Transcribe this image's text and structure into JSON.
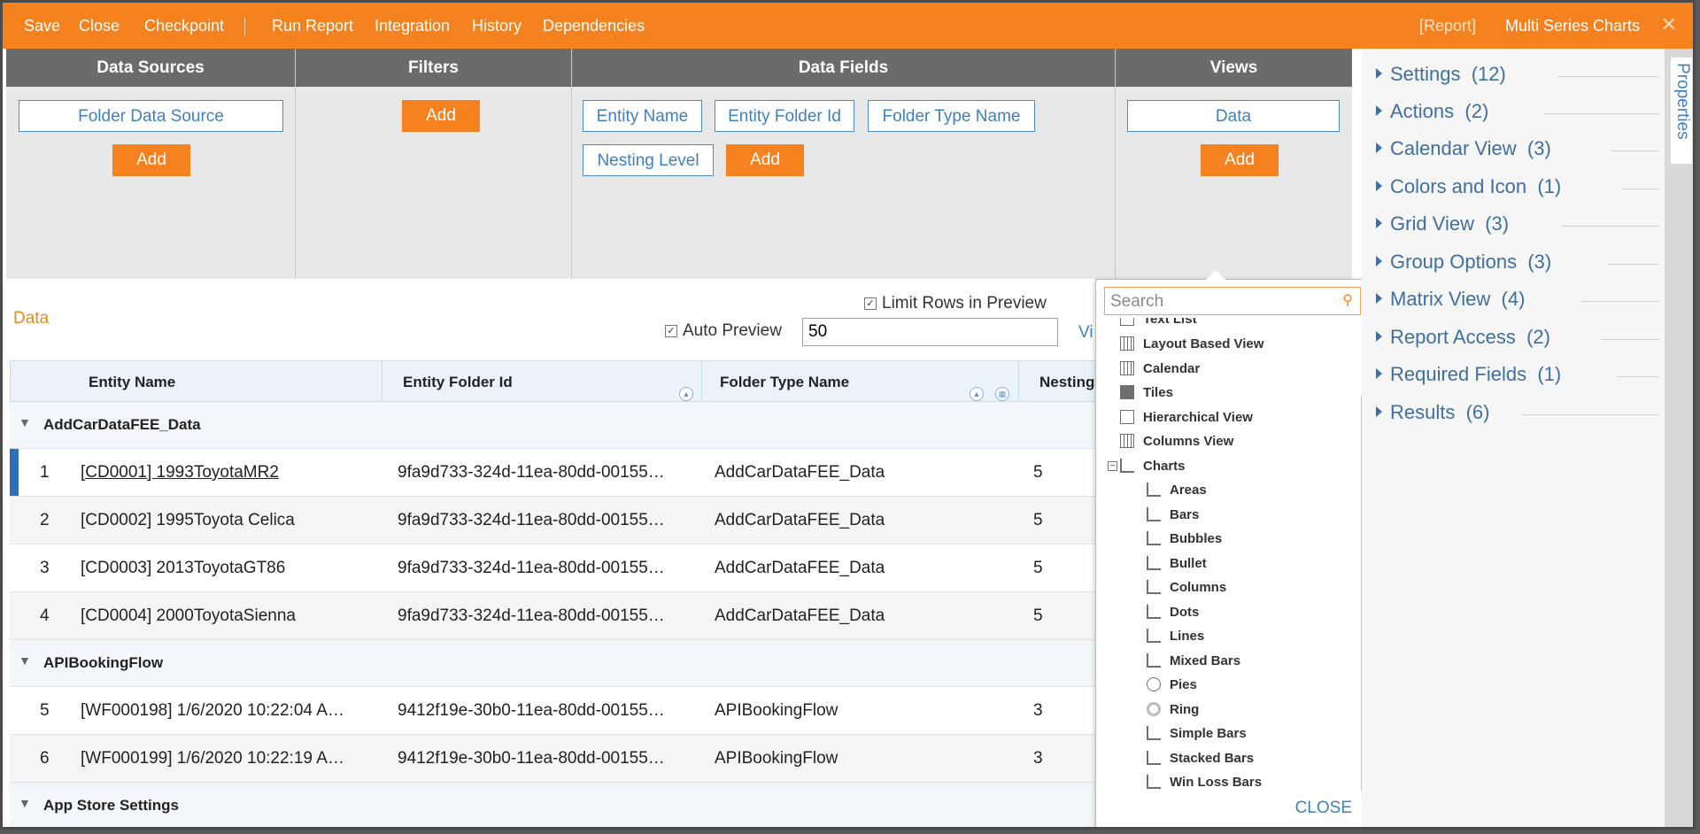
{
  "toolbar": {
    "save": "Save",
    "close": "Close",
    "checkpoint": "Checkpoint",
    "run_report": "Run Report",
    "integration": "Integration",
    "history": "History",
    "dependencies": "Dependencies",
    "report_tag": "[Report]",
    "title": "Multi Series Charts",
    "close_icon": "✕"
  },
  "columns": {
    "data_sources": {
      "title": "Data Sources",
      "items": [
        "Folder Data Source"
      ],
      "add": "Add"
    },
    "filters": {
      "title": "Filters",
      "add": "Add"
    },
    "data_fields": {
      "title": "Data Fields",
      "items": [
        "Entity Name",
        "Entity Folder Id",
        "Folder Type Name",
        "Nesting Level"
      ],
      "add": "Add"
    },
    "views": {
      "title": "Views",
      "items": [
        "Data"
      ],
      "add": "Add"
    }
  },
  "preview": {
    "label": "Data",
    "limit_rows": "Limit Rows in Preview",
    "auto_preview": "Auto Preview",
    "rows_value": "50",
    "view_link": "Vi"
  },
  "grid": {
    "headers": [
      "Entity Name",
      "Entity Folder Id",
      "Folder Type Name",
      "Nesting"
    ],
    "groups": [
      {
        "name": "AddCarDataFEE_Data"
      },
      {
        "name": "APIBookingFlow"
      },
      {
        "name": "App Store Settings"
      }
    ],
    "rows": [
      {
        "num": "1",
        "name": "[CD0001] 1993ToyotaMR2",
        "folder_id": "9fa9d733-324d-11ea-80dd-00155…",
        "type": "AddCarDataFEE_Data",
        "nesting": "5"
      },
      {
        "num": "2",
        "name": "[CD0002] 1995Toyota Celica",
        "folder_id": "9fa9d733-324d-11ea-80dd-00155…",
        "type": "AddCarDataFEE_Data",
        "nesting": "5"
      },
      {
        "num": "3",
        "name": "[CD0003] 2013ToyotaGT86",
        "folder_id": "9fa9d733-324d-11ea-80dd-00155…",
        "type": "AddCarDataFEE_Data",
        "nesting": "5"
      },
      {
        "num": "4",
        "name": "[CD0004] 2000ToyotaSienna",
        "folder_id": "9fa9d733-324d-11ea-80dd-00155…",
        "type": "AddCarDataFEE_Data",
        "nesting": "5"
      },
      {
        "num": "5",
        "name": "[WF000198] 1/6/2020 10:22:04 A…",
        "folder_id": "9412f19e-30b0-11ea-80dd-00155…",
        "type": "APIBookingFlow",
        "nesting": "3"
      },
      {
        "num": "6",
        "name": "[WF000199] 1/6/2020 10:22:19 A…",
        "folder_id": "9412f19e-30b0-11ea-80dd-00155…",
        "type": "APIBookingFlow",
        "nesting": "3"
      }
    ]
  },
  "view_picker": {
    "search_placeholder": "Search",
    "items": [
      "Text List",
      "Layout Based View",
      "Calendar",
      "Tiles",
      "Hierarchical View",
      "Columns View",
      "Charts"
    ],
    "chart_items": [
      "Areas",
      "Bars",
      "Bubbles",
      "Bullet",
      "Columns",
      "Dots",
      "Lines",
      "Mixed Bars",
      "Pies",
      "Ring",
      "Simple Bars",
      "Stacked Bars",
      "Win Loss Bars"
    ],
    "close": "CLOSE",
    "charts_expander": "−"
  },
  "properties": {
    "tab_label": "Properties",
    "sections": [
      {
        "name": "Settings",
        "count": "(12)"
      },
      {
        "name": "Actions",
        "count": "(2)"
      },
      {
        "name": "Calendar View",
        "count": "(3)"
      },
      {
        "name": "Colors and Icon",
        "count": "(1)"
      },
      {
        "name": "Grid View",
        "count": "(3)"
      },
      {
        "name": "Group Options",
        "count": "(3)"
      },
      {
        "name": "Matrix View",
        "count": "(4)"
      },
      {
        "name": "Report Access",
        "count": "(2)"
      },
      {
        "name": "Required Fields",
        "count": "(1)"
      },
      {
        "name": "Results",
        "count": "(6)"
      }
    ]
  },
  "colors": {
    "accent": "#f5821f",
    "link": "#3f80bf",
    "header_bg": "#6b6b6b"
  }
}
